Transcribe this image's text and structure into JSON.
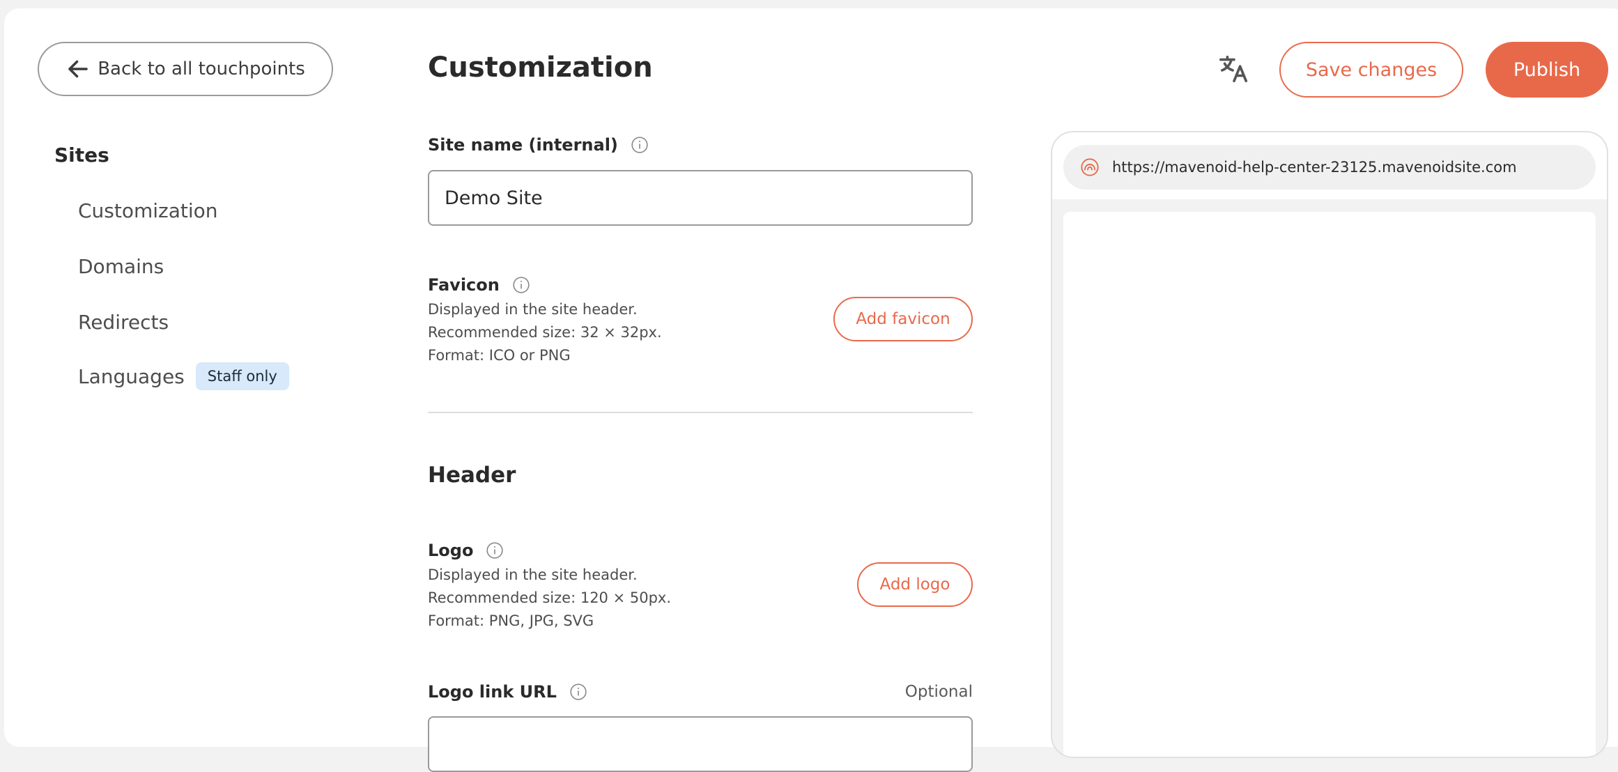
{
  "back_button": {
    "label": "Back to all touchpoints"
  },
  "sidebar": {
    "heading": "Sites",
    "items": [
      {
        "label": "Customization"
      },
      {
        "label": "Domains"
      },
      {
        "label": "Redirects"
      },
      {
        "label": "Languages",
        "badge": "Staff only"
      }
    ]
  },
  "header": {
    "title": "Customization",
    "save_label": "Save changes",
    "publish_label": "Publish",
    "translate_icon": "translate-icon"
  },
  "form": {
    "site_name": {
      "label": "Site name (internal)",
      "value": "Demo Site"
    },
    "favicon": {
      "label": "Favicon",
      "help": [
        "Displayed in the site header.",
        "Recommended size: 32 × 32px.",
        "Format: ICO or PNG"
      ],
      "button": "Add favicon"
    },
    "header_section": "Header",
    "logo": {
      "label": "Logo",
      "help": [
        "Displayed in the site header.",
        "Recommended size: 120 × 50px.",
        "Format: PNG, JPG, SVG"
      ],
      "button": "Add logo"
    },
    "logo_link": {
      "label": "Logo link URL",
      "optional": "Optional",
      "value": ""
    }
  },
  "preview": {
    "url": "https://mavenoid-help-center-23125.mavenoidsite.com"
  },
  "colors": {
    "accent": "#e8694a",
    "badge_bg": "#d7e9fb"
  }
}
